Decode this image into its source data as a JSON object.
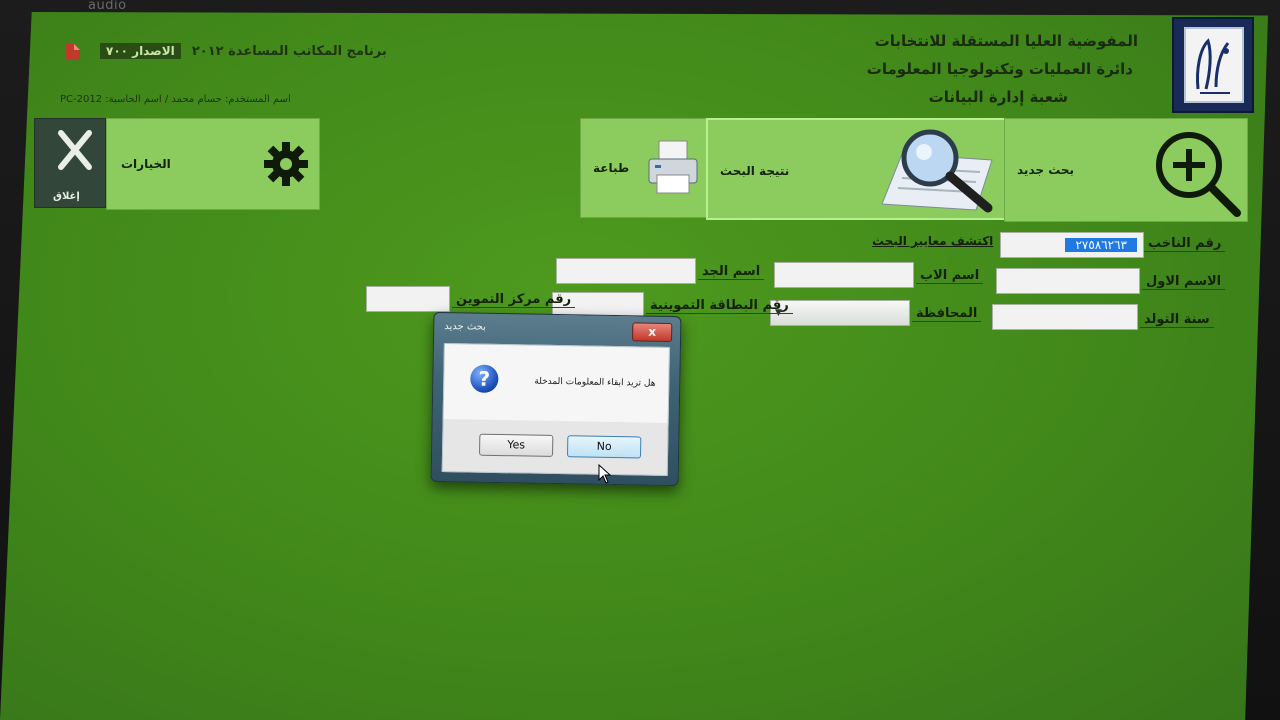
{
  "bezel": {
    "label": "audio"
  },
  "header": {
    "org_line1": "المفوضية العليا المستقلة للانتخابات",
    "org_line2": "دائرة العمليات وتكنولوجيا المعلومات",
    "org_line3": "شعبة إدارة البيانات",
    "app_title": "برنامج المكاتب المساعدة ٢٠١٢",
    "app_version": "الاصدار ٧٠٠",
    "user_line": "اسم المستخدم: حسام محمد / اسم الحاسبة: PC-2012"
  },
  "tiles": {
    "new_search": "بحث جديد",
    "search_result": "نتيجة البحث",
    "print": "طباعة",
    "options": "الخيارات",
    "exit": "إغلاق"
  },
  "form": {
    "criteria_link": "اكتشف معايير البحث",
    "voter_no_label": "رقم الناخب",
    "voter_no_value": "٢٧٥٨٦٢٦٣",
    "first_name_label": "الاسم الاول",
    "father_name_label": "اسم الاب",
    "grandfather_name_label": "اسم الجد",
    "birth_year_label": "سنة التولد",
    "governorate_label": "المحافظة",
    "ration_card_label": "رقم البطاقة التموينية",
    "ration_center_label": "رقم مركز التموين"
  },
  "dialog": {
    "title": "بحث جديد",
    "close": "x",
    "message": "هل تريد ابقاء المعلومات المدخلة",
    "icon_glyph": "?",
    "yes": "Yes",
    "no": "No"
  },
  "colors": {
    "screen_green": "#41881a",
    "tile_green": "#8ccc5e",
    "exit_tile": "#33463a",
    "selection_blue": "#1f7be3"
  }
}
